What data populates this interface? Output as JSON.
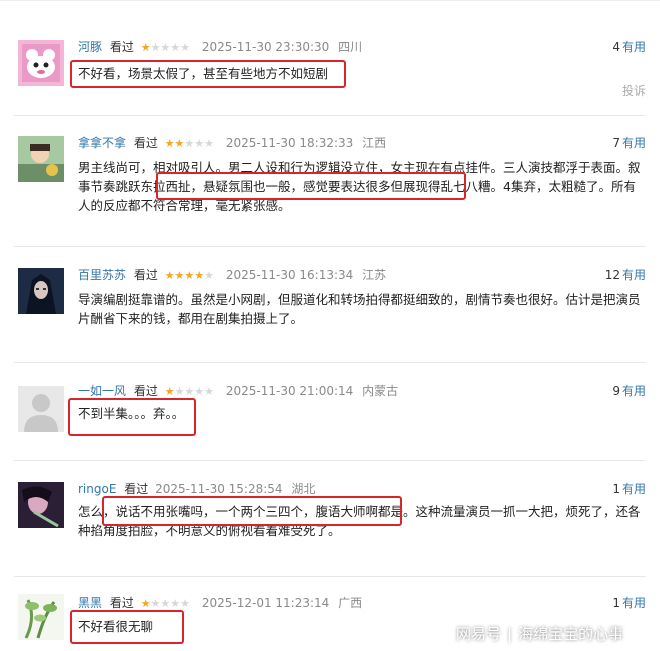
{
  "comments": [
    {
      "user": "河豚",
      "watched": "看过",
      "rating": 1,
      "time": "2025-11-30 23:30:30",
      "location": "四川",
      "useful_count": "4",
      "useful_label": "有用",
      "text": "不好看，场景太假了，甚至有些地方不如短剧",
      "report": "投诉"
    },
    {
      "user": "拿拿不拿",
      "watched": "看过",
      "rating": 2,
      "time": "2025-11-30 18:32:33",
      "location": "江西",
      "useful_count": "7",
      "useful_label": "有用",
      "text": "男主线尚可，相对吸引人。男二人设和行为逻辑没立住，女主现在有点挂件。三人演技都浮于表面。叙事节奏跳跃东拉西扯，悬疑氛围也一般，感觉要表达很多但展现得乱七八糟。4集弃，太粗糙了。所有人的反应都不符合常理，毫无紧张感。"
    },
    {
      "user": "百里苏苏",
      "watched": "看过",
      "rating": 4,
      "time": "2025-11-30 16:13:34",
      "location": "江苏",
      "useful_count": "12",
      "useful_label": "有用",
      "text": "导演编剧挺靠谱的。虽然是小网剧，但服道化和转场拍得都挺细致的，剧情节奏也很好。估计是把演员片酬省下来的钱，都用在剧集拍摄上了。"
    },
    {
      "user": "一如一风",
      "watched": "看过",
      "rating": 1,
      "time": "2025-11-30 21:00:14",
      "location": "内蒙古",
      "useful_count": "9",
      "useful_label": "有用",
      "text": "不到半集。。。弃。。"
    },
    {
      "user": "ringoE",
      "watched": "看过",
      "rating": 0,
      "time": "2025-11-30 15:28:54",
      "location": "湖北",
      "useful_count": "1",
      "useful_label": "有用",
      "text": "怎么，说话不用张嘴吗，一个两个三四个，腹语大师啊都是。这种流量演员一抓一大把，烦死了，还各种掐角度拍脸，不明意义的俯视看着难受死了。"
    },
    {
      "user": "黑黑",
      "watched": "看过",
      "rating": 1,
      "time": "2025-12-01 11:23:14",
      "location": "广西",
      "useful_count": "1",
      "useful_label": "有用",
      "text": "不好看很无聊"
    }
  ],
  "watermark": {
    "brand": "网易号",
    "author": "海绵宝宝的心事"
  }
}
